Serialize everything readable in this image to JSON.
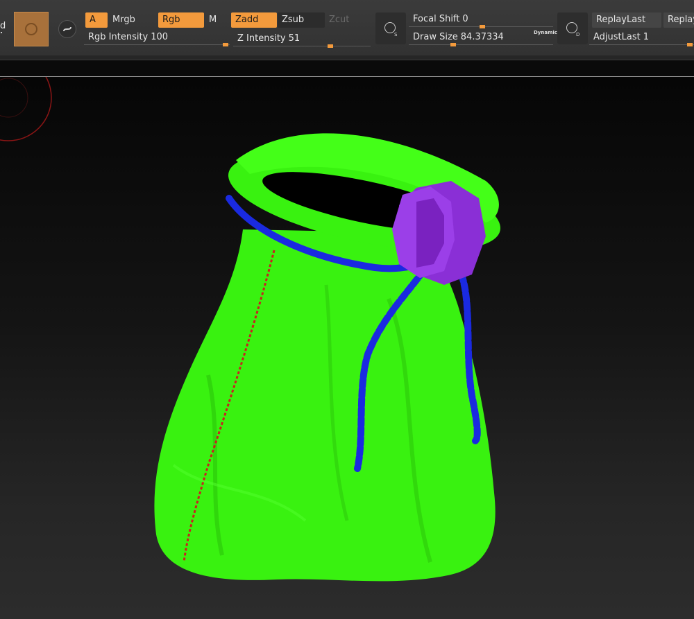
{
  "toolbar": {
    "left_cut_glyph": "d",
    "material_tile_color": "#a8713b",
    "alpha_button": "A",
    "mrgb_button": "Mrgb",
    "rgb_button": "Rgb",
    "m_button": "M",
    "rgb_intensity_label": "Rgb Intensity",
    "rgb_intensity_value": "100",
    "zadd_button": "Zadd",
    "zsub_button": "Zsub",
    "zcut_button": "Zcut",
    "z_intensity_label": "Z Intensity",
    "z_intensity_value": "51",
    "focal_shift_label": "Focal Shift",
    "focal_shift_value": "0",
    "draw_size_label": "Draw Size",
    "draw_size_value": "84.37334",
    "dynamic_label": "Dynamic",
    "replay_last_button": "ReplayLast",
    "replay_button": "Replay",
    "adjust_last_label": "AdjustLast",
    "adjust_last_value": "1",
    "focal_icon_letter": "S",
    "draw_icon_letter": "D",
    "accent_color": "#f39a3c"
  },
  "viewport": {
    "model_color": "#39f210",
    "rope_color": "#1a2ae0",
    "bead_color": "#8a2fd6",
    "stitch_color": "#c8241e",
    "brush_cursor_color": "#8a1515"
  }
}
